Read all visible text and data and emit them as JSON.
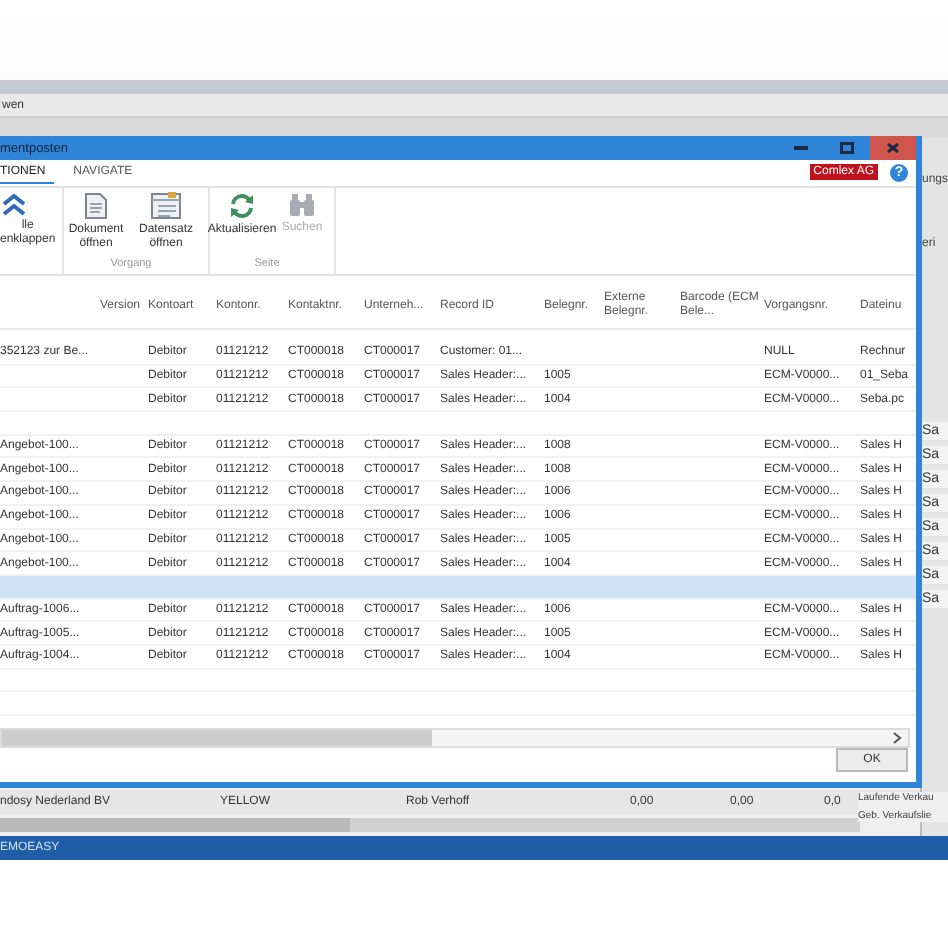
{
  "background_app": {
    "menu_label": "wen",
    "side_texts": [
      "ungs",
      "eri"
    ],
    "side_items": [
      "Sa",
      "Sa",
      "Sa",
      "Sa",
      "Sa",
      "Sa",
      "Sa",
      "Sa"
    ],
    "list_row": [
      "ndosy Nederland BV",
      "YELLOW",
      "Rob Verhoff",
      "0,00",
      "0,00",
      "0,0"
    ],
    "side_links": [
      "Laufende Verkau",
      "Geb. Verkaufslie"
    ],
    "status_bar": "EMOEASY"
  },
  "dialog": {
    "title": "mentposten",
    "tabs": [
      {
        "label": "TIONEN",
        "selected": true
      },
      {
        "label": "NAVIGATE",
        "selected": false
      }
    ],
    "company_badge": "Comlex AG",
    "help": "?",
    "ribbon_groups": [
      {
        "buttons": [
          {
            "kind": "collapse",
            "label": "lle enklappen",
            "disabled": false
          }
        ]
      },
      {
        "label": "Vorgang",
        "buttons": [
          {
            "kind": "document",
            "label": "Dokument öffnen",
            "disabled": false
          },
          {
            "kind": "record",
            "label": "Datensatz öffnen",
            "disabled": false
          }
        ]
      },
      {
        "label": "Seite",
        "buttons": [
          {
            "kind": "refresh",
            "label": "Aktualisieren",
            "disabled": false
          },
          {
            "kind": "search",
            "label": "Suchen",
            "disabled": true
          }
        ]
      }
    ],
    "columns": [
      null,
      "Version",
      "Kontoart",
      "Kontonr.",
      "Kontaktnr.",
      "Unterneh...",
      "Record ID",
      "Belegnr.",
      "Externe Belegnr.",
      "Barcode (ECM Bele...",
      "Vorgangsnr.",
      "Dateinu"
    ],
    "rows": [
      {
        "selected": false,
        "cells": [
          "352123 zur Be...",
          null,
          "Debitor",
          "01121212",
          "CT000018",
          "CT000017",
          "Customer: 01...",
          null,
          null,
          null,
          "NULL",
          "Rechnur"
        ]
      },
      {
        "selected": false,
        "cells": [
          null,
          null,
          "Debitor",
          "01121212",
          "CT000018",
          "CT000017",
          "Sales Header:...",
          "1005",
          null,
          null,
          "ECM-V0000...",
          "01_Seba"
        ]
      },
      {
        "selected": false,
        "cells": [
          null,
          null,
          "Debitor",
          "01121212",
          "CT000018",
          "CT000017",
          "Sales Header:...",
          "1004",
          null,
          null,
          "ECM-V0000...",
          "Seba.pc"
        ]
      },
      {
        "selected": false,
        "cells": []
      },
      {
        "selected": false,
        "cells": [
          "Angebot-100...",
          null,
          "Debitor",
          "01121212",
          "CT000018",
          "CT000017",
          "Sales Header:...",
          "1008",
          null,
          null,
          "ECM-V0000...",
          "Sales H"
        ]
      },
      {
        "selected": false,
        "cells": [
          "Angebot-100...",
          null,
          "Debitor",
          "01121212",
          "CT000018",
          "CT000017",
          "Sales Header:...",
          "1008",
          null,
          null,
          "ECM-V0000...",
          "Sales H"
        ]
      },
      {
        "selected": false,
        "cells": [
          "Angebot-100...",
          null,
          "Debitor",
          "01121212",
          "CT000018",
          "CT000017",
          "Sales Header:...",
          "1006",
          null,
          null,
          "ECM-V0000...",
          "Sales H"
        ]
      },
      {
        "selected": false,
        "cells": [
          "Angebot-100...",
          null,
          "Debitor",
          "01121212",
          "CT000018",
          "CT000017",
          "Sales Header:...",
          "1006",
          null,
          null,
          "ECM-V0000...",
          "Sales H"
        ]
      },
      {
        "selected": false,
        "cells": [
          "Angebot-100...",
          null,
          "Debitor",
          "01121212",
          "CT000018",
          "CT000017",
          "Sales Header:...",
          "1005",
          null,
          null,
          "ECM-V0000...",
          "Sales H"
        ]
      },
      {
        "selected": false,
        "cells": [
          "Angebot-100...",
          null,
          "Debitor",
          "01121212",
          "CT000018",
          "CT000017",
          "Sales Header:...",
          "1004",
          null,
          null,
          "ECM-V0000...",
          "Sales H"
        ]
      },
      {
        "selected": true,
        "cells": []
      },
      {
        "selected": false,
        "cells": [
          "Auftrag-1006...",
          null,
          "Debitor",
          "01121212",
          "CT000018",
          "CT000017",
          "Sales Header:...",
          "1006",
          null,
          null,
          "ECM-V0000...",
          "Sales H"
        ]
      },
      {
        "selected": false,
        "cells": [
          "Auftrag-1005...",
          null,
          "Debitor",
          "01121212",
          "CT000018",
          "CT000017",
          "Sales Header:...",
          "1005",
          null,
          null,
          "ECM-V0000...",
          "Sales H"
        ]
      },
      {
        "selected": false,
        "cells": [
          "Auftrag-1004...",
          null,
          "Debitor",
          "01121212",
          "CT000018",
          "CT000017",
          "Sales Header:...",
          "1004",
          null,
          null,
          "ECM-V0000...",
          "Sales H"
        ]
      }
    ],
    "ok_button": "OK"
  }
}
